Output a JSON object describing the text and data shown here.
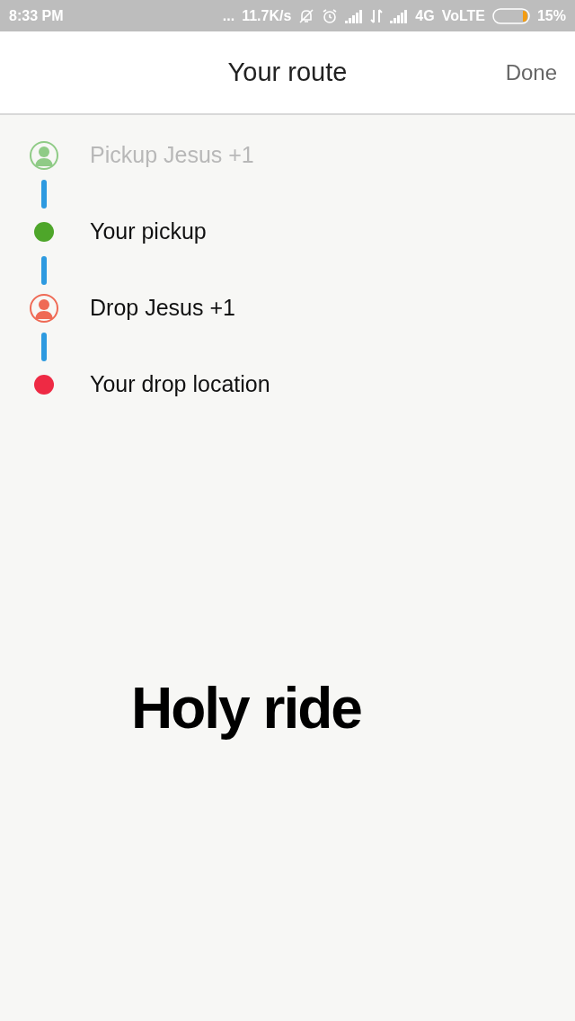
{
  "status_bar": {
    "time": "8:33 PM",
    "more": "...",
    "speed": "11.7K/s",
    "network": "4G",
    "volte": "VoLTE",
    "battery": "15%"
  },
  "header": {
    "title": "Your route",
    "action": "Done"
  },
  "stops": [
    {
      "kind": "person",
      "label": "Pickup Jesus +1",
      "color": "#8fcb86",
      "disabled": true
    },
    {
      "kind": "dot",
      "label": "Your pickup",
      "color": "#4ea62a",
      "disabled": false
    },
    {
      "kind": "person",
      "label": "Drop Jesus +1",
      "color": "#ef6a55",
      "disabled": false
    },
    {
      "kind": "dot",
      "label": "Your drop location",
      "color": "#ee2a44",
      "disabled": false
    }
  ],
  "caption": "Holy ride"
}
